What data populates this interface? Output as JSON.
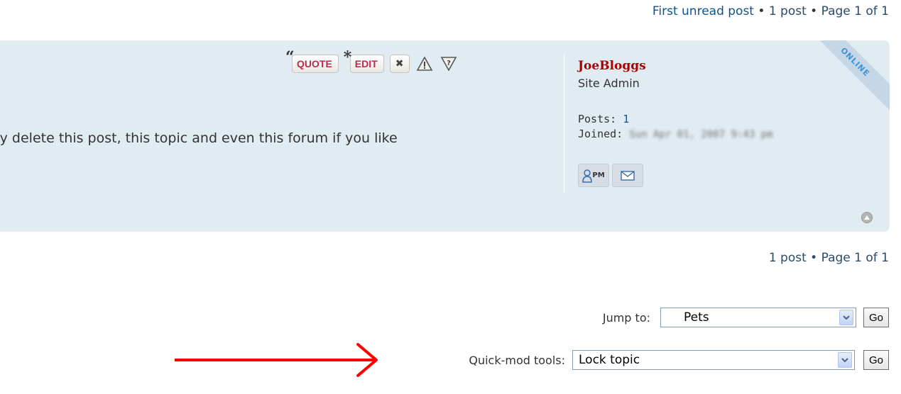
{
  "top_pagination": {
    "first_unread": "First unread post",
    "separator": "•",
    "post_count": "1 post",
    "page": "Page 1 of 1"
  },
  "post": {
    "buttons": {
      "quote": "QUOTE",
      "edit": "EDIT"
    },
    "icons": [
      "quote-icon",
      "edit-icon",
      "delete-icon",
      "report-icon",
      "info-icon"
    ],
    "content": "ay delete this post, this topic and even this forum if you like",
    "status_ribbon": "ONLINE"
  },
  "profile": {
    "username": "JoeBloggs",
    "rank": "Site Admin",
    "posts_label": "Posts:",
    "posts_value": "1",
    "joined_label": "Joined:",
    "joined_value": "Sun Apr 01, 2007 9:43 pm",
    "pm_label": "PM"
  },
  "bottom_pagination": {
    "post_count": "1 post",
    "separator": "•",
    "page": "Page 1 of 1"
  },
  "jump_to": {
    "label": "Jump to:",
    "selected": "Pets",
    "go": "Go"
  },
  "quick_mod": {
    "label": "Quick-mod tools:",
    "selected": "Lock topic",
    "go": "Go"
  },
  "colors": {
    "post_bg": "#e1ebf2",
    "link": "#105289",
    "button_text": "#bc2a4d",
    "username": "#aa0000",
    "arrow": "#ff0000"
  }
}
